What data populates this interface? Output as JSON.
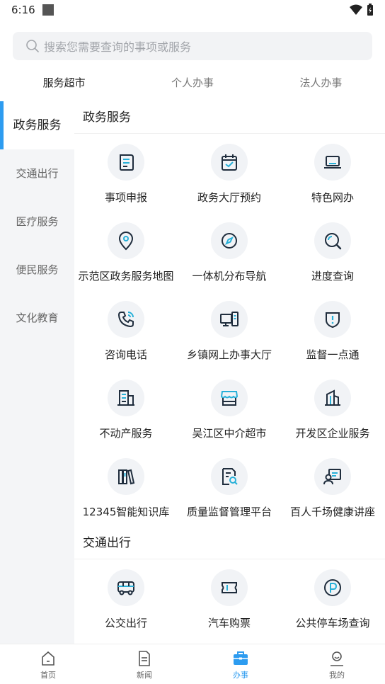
{
  "status": {
    "time": "6:16"
  },
  "search": {
    "placeholder": "搜索您需要查询的事项或服务"
  },
  "top_tabs": [
    {
      "label": "服务超市"
    },
    {
      "label": "个人办事"
    },
    {
      "label": "法人办事"
    }
  ],
  "sidebar": {
    "items": [
      {
        "label": "政务服务"
      },
      {
        "label": "交通出行"
      },
      {
        "label": "医疗服务"
      },
      {
        "label": "便民服务"
      },
      {
        "label": "文化教育"
      }
    ]
  },
  "sections": [
    {
      "title": "政务服务",
      "items": [
        {
          "label": "事项申报",
          "icon": "scroll-icon"
        },
        {
          "label": "政务大厅预约",
          "icon": "calendar-check-icon"
        },
        {
          "label": "特色网办",
          "icon": "laptop-icon"
        },
        {
          "label": "示范区政务服务地图",
          "icon": "map-pin-icon"
        },
        {
          "label": "一体机分布导航",
          "icon": "compass-icon"
        },
        {
          "label": "进度查询",
          "icon": "search-icon"
        },
        {
          "label": "咨询电话",
          "icon": "phone-icon"
        },
        {
          "label": "乡镇网上办事大厅",
          "icon": "computer-icon"
        },
        {
          "label": "监督一点通",
          "icon": "shield-alert-icon"
        },
        {
          "label": "不动产服务",
          "icon": "building-icon"
        },
        {
          "label": "吴江区中介超市",
          "icon": "store-icon"
        },
        {
          "label": "开发区企业服务",
          "icon": "office-tower-icon"
        },
        {
          "label": "12345智能知识库",
          "icon": "books-icon"
        },
        {
          "label": "质量监督管理平台",
          "icon": "document-search-icon"
        },
        {
          "label": "百人千场健康讲座",
          "icon": "lecture-icon"
        }
      ]
    },
    {
      "title": "交通出行",
      "items": [
        {
          "label": "公交出行",
          "icon": "bus-icon"
        },
        {
          "label": "汽车购票",
          "icon": "ticket-icon"
        },
        {
          "label": "公共停车场查询",
          "icon": "parking-icon"
        }
      ]
    }
  ],
  "bottom_nav": [
    {
      "label": "首页",
      "icon": "home-icon"
    },
    {
      "label": "新闻",
      "icon": "news-icon"
    },
    {
      "label": "办事",
      "icon": "briefcase-icon",
      "active": true
    },
    {
      "label": "我的",
      "icon": "user-icon"
    }
  ],
  "colors": {
    "accent": "#2d9cf0",
    "icon_dark": "#1f2d3d",
    "icon_accent": "#27b0d8"
  }
}
